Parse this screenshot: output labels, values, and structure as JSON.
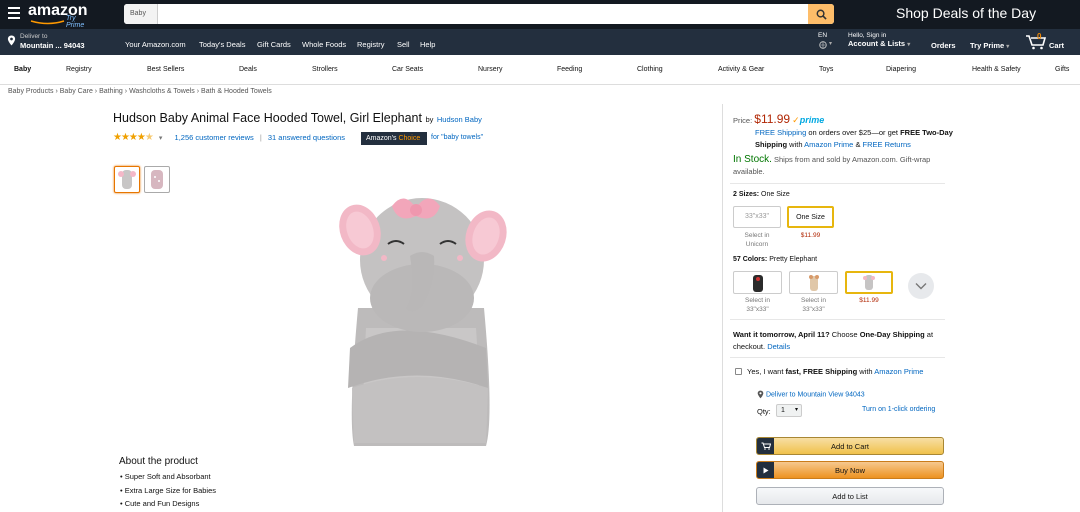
{
  "header": {
    "logo_text": "amazon",
    "logo_sub": "Try Prime",
    "search_category": "Baby",
    "search_placeholder": "",
    "promo": "Shop Deals of the Day",
    "deliver_line1": "Deliver to",
    "deliver_line2": "Mountain ... 94043",
    "nav_links": [
      "Your Amazon.com",
      "Today's Deals",
      "Gift Cards",
      "Whole Foods",
      "Registry",
      "Sell",
      "Help"
    ],
    "language": "EN",
    "account_line1": "Hello, Sign in",
    "account_line2": "Account & Lists",
    "orders": "Orders",
    "try_prime": "Try Prime",
    "cart_count": "0",
    "cart_label": "Cart"
  },
  "categories": [
    "Baby",
    "Registry",
    "Best Sellers",
    "Deals",
    "Strollers",
    "Car Seats",
    "Nursery",
    "Feeding",
    "Clothing",
    "Activity & Gear",
    "Toys",
    "Diapering",
    "Health & Safety",
    "Gifts"
  ],
  "breadcrumb": [
    "Baby Products",
    "Baby Care",
    "Bathing",
    "Washcloths & Towels",
    "Bath & Hooded Towels"
  ],
  "product": {
    "title": "Hudson Baby Animal Face Hooded Towel, Girl Elephant",
    "by": "by",
    "brand": "Hudson Baby",
    "rating": 4.5,
    "reviews": "1,256 customer reviews",
    "answered": "31 answered questions",
    "choice_badge_a": "Amazon's",
    "choice_badge_b": "Choice",
    "choice_for": "for \"baby towels\""
  },
  "about": {
    "heading": "About the product",
    "bullets": [
      "Super Soft and Absorbant",
      "Extra Large Size for Babies",
      "Cute and Fun Designs"
    ]
  },
  "buybox": {
    "price_label": "Price:",
    "price": "$11.99",
    "prime": "prime",
    "shipping_free": "FREE Shipping",
    "shipping_text": " on orders over $25—or get ",
    "shipping_bold": "FREE Two-Day Shipping",
    "shipping_with": " with ",
    "amazon_prime": "Amazon Prime",
    "and": " & ",
    "free_returns": "FREE Returns",
    "in_stock": "In Stock.",
    "ships_from": " Ships from and sold by Amazon.com. Gift-wrap available.",
    "sizes_label": "2 Sizes:",
    "sizes_value": "One Size",
    "size_options": [
      {
        "label": "33\"x33\"",
        "sub": "Select in Unicorn"
      },
      {
        "label": "One Size",
        "sub": "$11.99"
      }
    ],
    "colors_label": "57 Colors:",
    "colors_value": "Pretty Elephant",
    "color_options": [
      {
        "sub": "Select in 33\"x33\""
      },
      {
        "sub": "Select in 33\"x33\""
      },
      {
        "sub": "$11.99"
      }
    ],
    "want_it": "Want it tomorrow, April 11?",
    "choose": " Choose ",
    "one_day": "One-Day Shipping",
    "at_checkout": " at checkout. ",
    "details": "Details",
    "yes_fast_a": "Yes, I want ",
    "yes_fast_b": "fast, FREE Shipping",
    "yes_fast_c": " with ",
    "yes_prime": "Amazon Prime",
    "deliver_to": "Deliver to Mountain View 94043",
    "qty_label": "Qty:",
    "qty_value": "1",
    "one_click": "Turn on 1-click ordering",
    "add_to_cart": "Add to Cart",
    "buy_now": "Buy Now",
    "add_to_list": "Add to List"
  },
  "colors": {
    "nav_dark": "#131921",
    "nav_mid": "#232f3e",
    "price_red": "#b12704",
    "link_blue": "#0066c0",
    "stock_green": "#007600",
    "search_orange": "#febd69"
  }
}
